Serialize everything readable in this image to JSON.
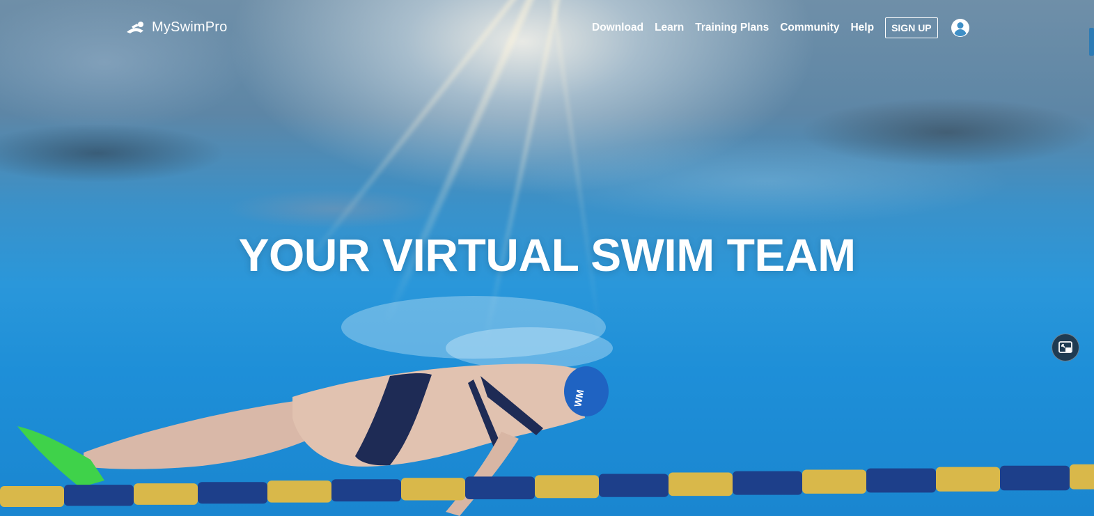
{
  "brand": {
    "name": "MySwimPro",
    "logo_icon": "swimmer-logo-icon"
  },
  "nav": {
    "links": [
      {
        "label": "Download"
      },
      {
        "label": "Learn"
      },
      {
        "label": "Training Plans"
      },
      {
        "label": "Community"
      },
      {
        "label": "Help"
      }
    ],
    "signup_label": "SIGN UP",
    "account_icon": "user-circle-icon"
  },
  "hero": {
    "headline": "YOUR VIRTUAL SWIM TEAM",
    "pip_icon": "picture-in-picture-icon"
  },
  "colors": {
    "water_deep": "#1a86d0",
    "water_light": "#3a91c9",
    "lane_yellow": "#d9b84a",
    "lane_blue": "#1d3f8a",
    "fin_green": "#3fd24a",
    "cap_blue": "#1f63c2"
  }
}
